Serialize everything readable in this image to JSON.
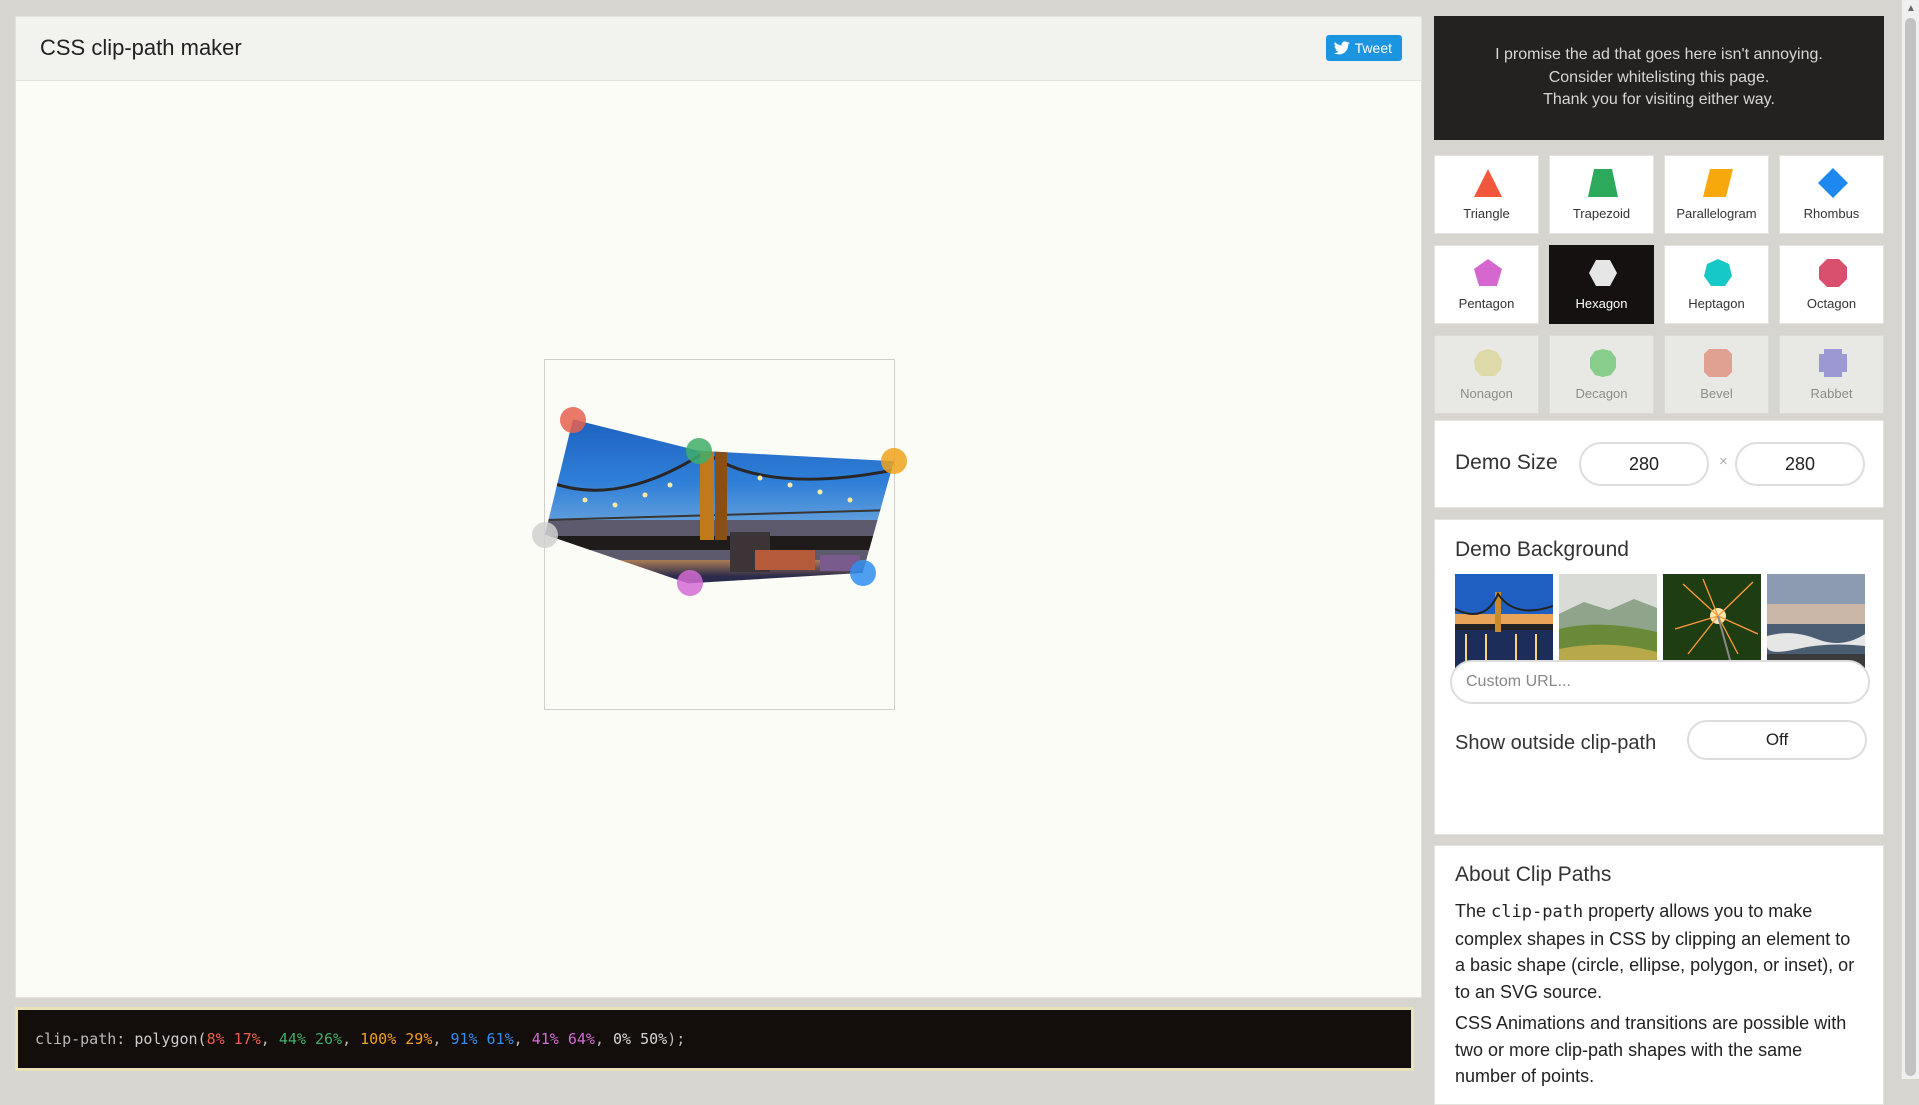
{
  "app": {
    "title": "CSS clip-path maker",
    "tweet_label": "Tweet"
  },
  "code": {
    "property": "clip-path:",
    "func": " polygon(",
    "points": [
      {
        "text": "8% 17%",
        "color": "#e8614f"
      },
      {
        "text": "44% 26%",
        "color": "#3fae6a"
      },
      {
        "text": "100% 29%",
        "color": "#f0a21c"
      },
      {
        "text": "91% 61%",
        "color": "#2f8ef0"
      },
      {
        "text": "41% 64%",
        "color": "#d46bd4"
      },
      {
        "text": "0% 50%",
        "color": "#d6d6d6"
      }
    ],
    "sep": ", ",
    "end": ");"
  },
  "ad": {
    "line1": "I promise the ad that goes here isn't annoying.",
    "line2": "Consider whitelisting this page.",
    "line3": "Thank you for visiting either way."
  },
  "shapes": [
    {
      "label": "Triangle",
      "color": "#f2573e",
      "icon": "triangle-icon"
    },
    {
      "label": "Trapezoid",
      "color": "#2ca95b",
      "icon": "trapezoid-icon"
    },
    {
      "label": "Parallelogram",
      "color": "#f7a80d",
      "icon": "parallelogram-icon"
    },
    {
      "label": "Rhombus",
      "color": "#1e88ef",
      "icon": "rhombus-icon"
    },
    {
      "label": "Pentagon",
      "color": "#d667cf",
      "icon": "pentagon-icon"
    },
    {
      "label": "Hexagon",
      "color": "#e6e6e6",
      "icon": "hexagon-icon",
      "selected": true
    },
    {
      "label": "Heptagon",
      "color": "#16c8c8",
      "icon": "heptagon-icon"
    },
    {
      "label": "Octagon",
      "color": "#d9506f",
      "icon": "octagon-icon"
    },
    {
      "label": "Nonagon",
      "color": "#e9e07a",
      "icon": "nonagon-icon"
    },
    {
      "label": "Decagon",
      "color": "#2bc43c",
      "icon": "decagon-icon"
    },
    {
      "label": "Bevel",
      "color": "#f0644a",
      "icon": "bevel-icon"
    },
    {
      "label": "Rabbet",
      "color": "#5650d8",
      "icon": "rabbet-icon"
    }
  ],
  "demo_size": {
    "heading": "Demo Size",
    "width": "280",
    "height": "280",
    "times": "×"
  },
  "demo_background": {
    "heading": "Demo Background",
    "thumbnails": [
      "bridge-thumbnail",
      "landscape-thumbnail",
      "sparkler-thumbnail",
      "ocean-thumbnail"
    ],
    "custom_url_placeholder": "Custom URL...",
    "show_outside_label": "Show outside clip-path",
    "show_outside_value": "Off"
  },
  "about": {
    "heading": "About Clip Paths",
    "p1_before": "The ",
    "p1_code": "clip-path",
    "p1_after": " property allows you to make complex shapes in CSS by clipping an element to a basic shape (circle, ellipse, polygon, or inset), or to an SVG source.",
    "p2": "CSS Animations and transitions are possible with two or more clip-path shapes with the same number of points."
  }
}
